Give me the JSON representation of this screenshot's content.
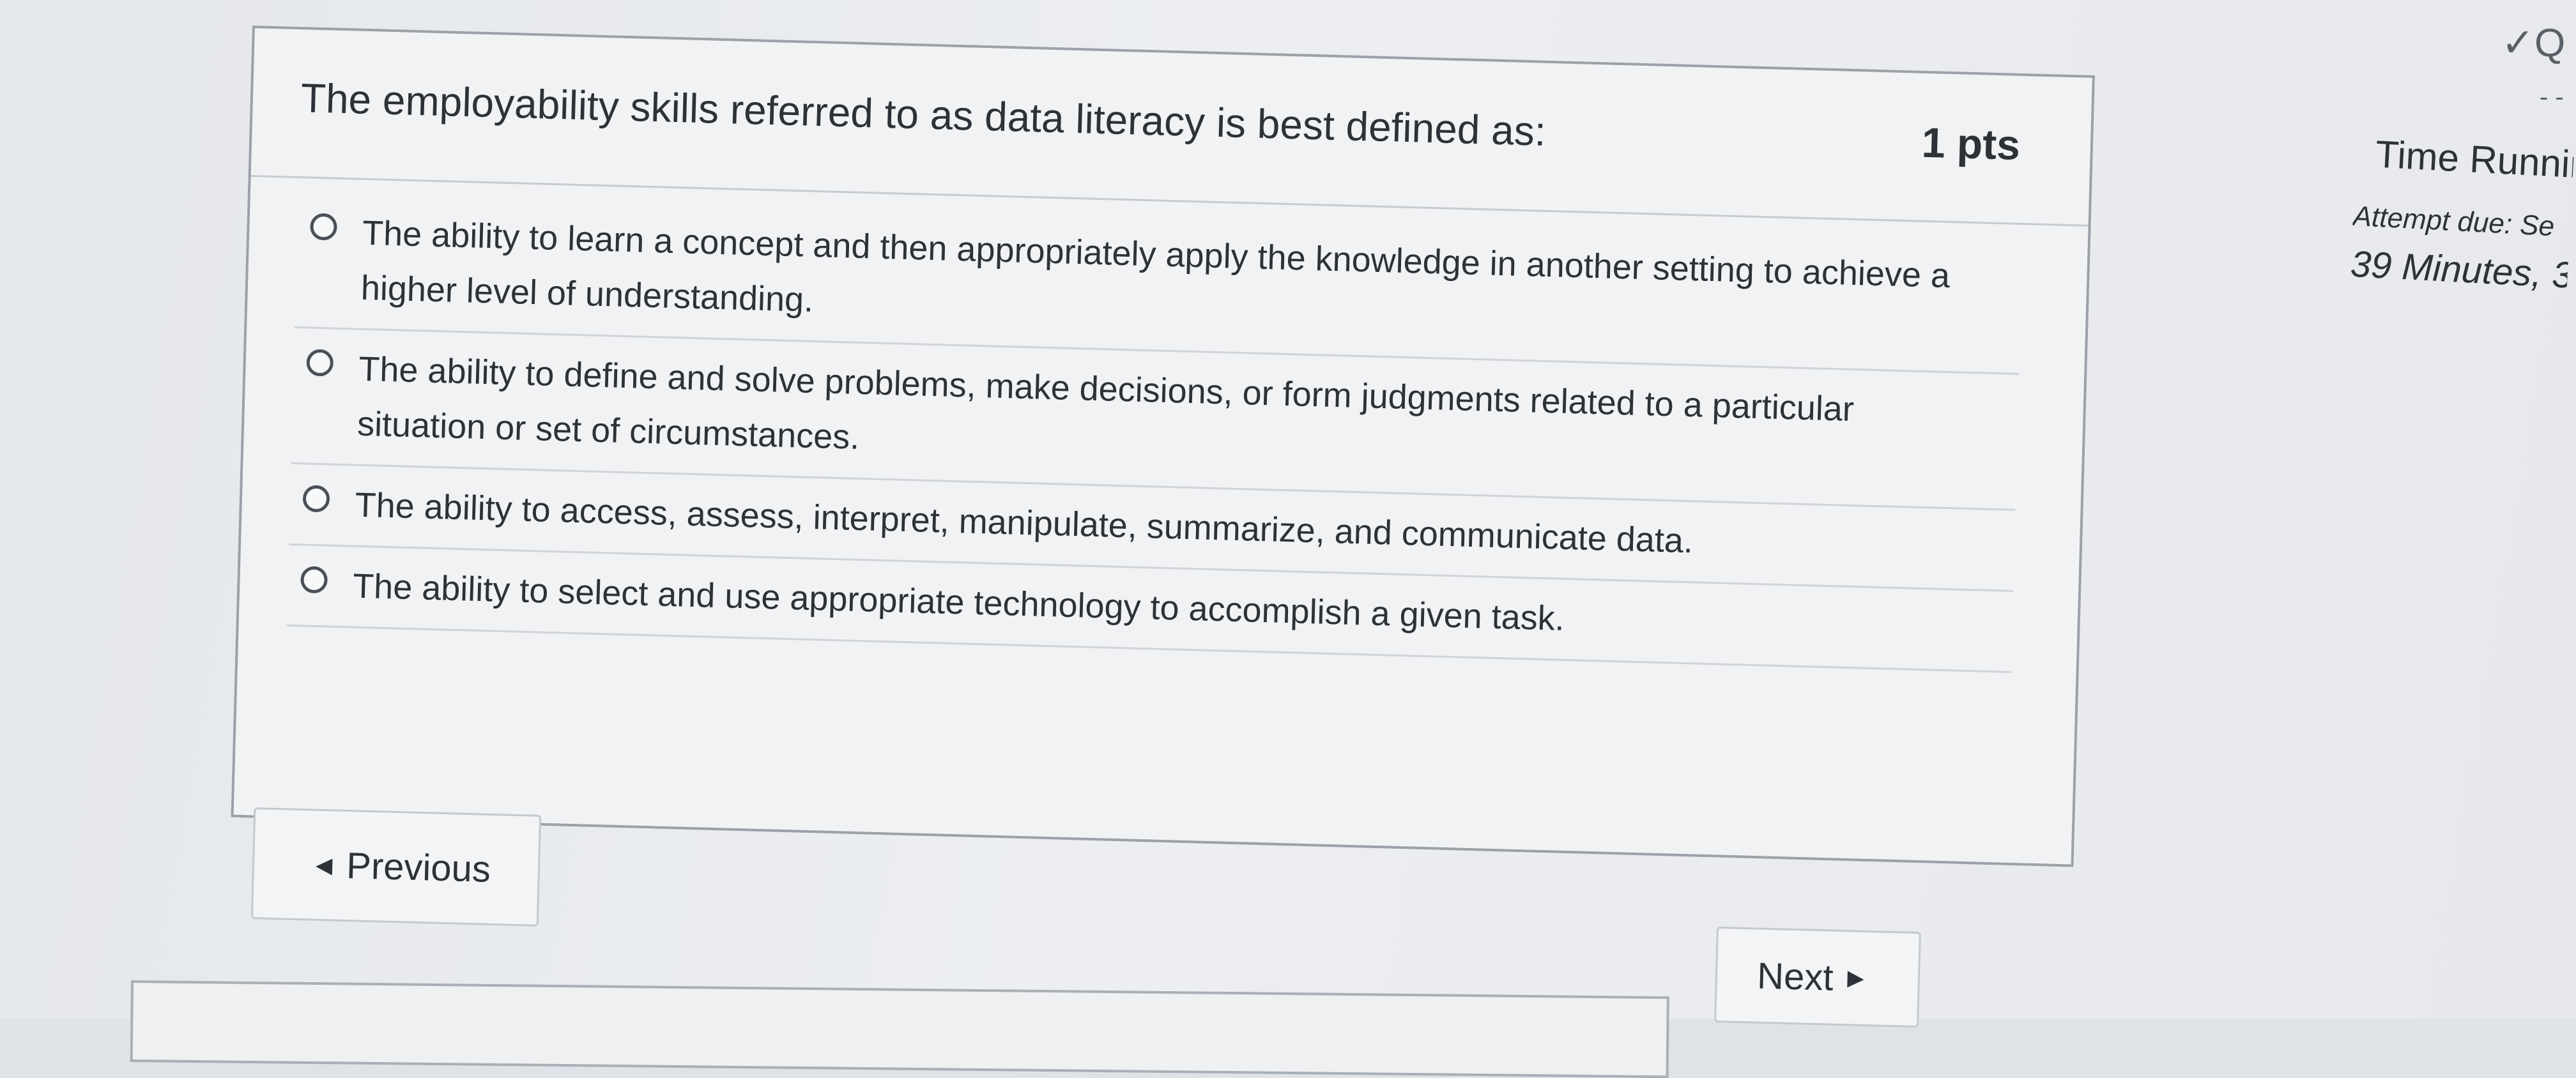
{
  "question": {
    "text": "The employability skills referred to as data literacy is best defined as:",
    "points": "1 pts",
    "answers": [
      {
        "text": "The ability to learn a concept and then appropriately apply the knowledge in another setting to achieve a higher level of understanding."
      },
      {
        "text": "The ability to define and solve problems, make decisions, or form judgments related to a particular situation or set of circumstances."
      },
      {
        "text": "The ability to access, assess, interpret, manipulate, summarize, and communicate data."
      },
      {
        "text": "The ability to select and use appropriate technology to accomplish a given task."
      }
    ]
  },
  "navigation": {
    "previous_label": "Previous",
    "next_label": "Next"
  },
  "sidebar": {
    "time_label": "Time Runnir",
    "attempt_due": "Attempt due: Se",
    "minutes": "39 Minutes, 3"
  },
  "top_icons": {
    "icons": [
      "checkmark-icon",
      "search-icon"
    ]
  },
  "colors": {
    "border": "#9aa1a9",
    "text": "#2d3238",
    "background": "#e4e7eb"
  }
}
